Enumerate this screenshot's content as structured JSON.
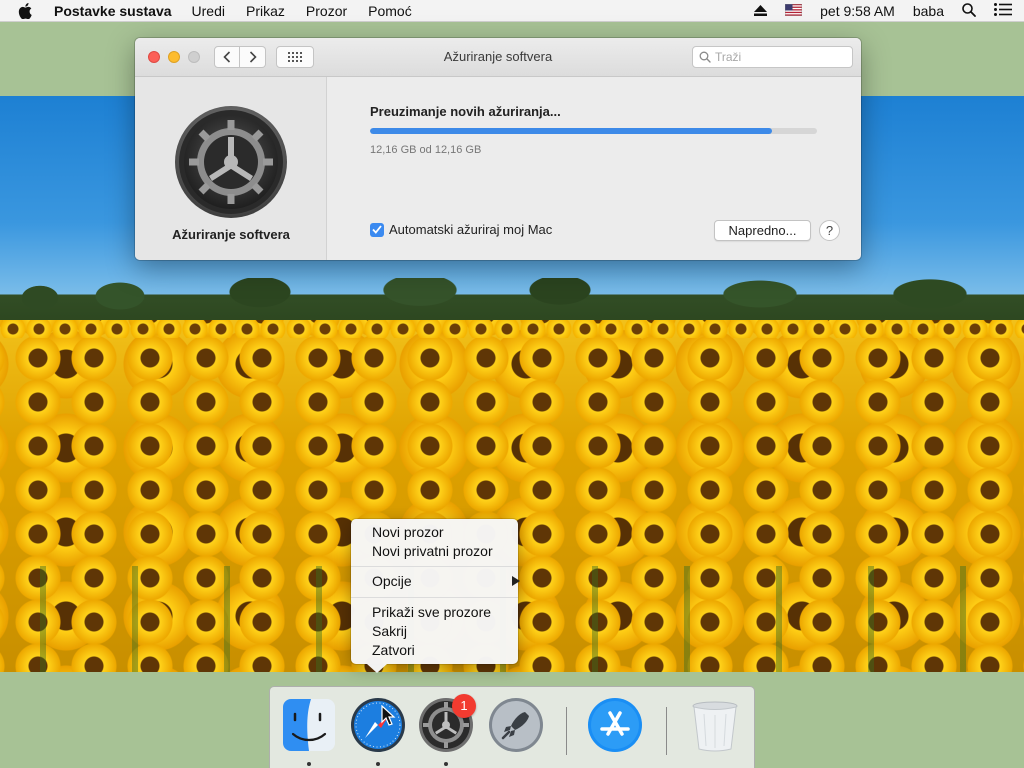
{
  "menubar": {
    "app_name": "Postavke sustava",
    "items": [
      "Uredi",
      "Prikaz",
      "Prozor",
      "Pomoć"
    ],
    "clock": "pet 9:58 AM",
    "user": "baba"
  },
  "window": {
    "title": "Ažuriranje softvera",
    "search_placeholder": "Traži",
    "sidebar_title": "Ažuriranje softvera",
    "status_title": "Preuzimanje novih ažuriranja...",
    "progress_fraction": 0.9,
    "progress_text": "12,16 GB od 12,16 GB",
    "auto_update_label": "Automatski ažuriraj moj Mac",
    "auto_update_checked": true,
    "advanced_button": "Napredno...",
    "help_button": "?"
  },
  "context_menu": {
    "group1": [
      "Novi prozor",
      "Novi privatni prozor"
    ],
    "group2": [
      "Opcije"
    ],
    "group3": [
      "Prikaži sve prozore",
      "Sakrij",
      "Zatvori"
    ]
  },
  "dock": {
    "icons": [
      "finder-icon",
      "safari-icon",
      "system-preferences-icon",
      "launchpad-icon",
      "app-store-icon",
      "trash-icon"
    ],
    "system_preferences_badge": "1"
  },
  "colors": {
    "accent": "#3d8ae8",
    "badge": "#f23b30",
    "close": "#fc5f57",
    "minimize": "#fdbc2e"
  }
}
